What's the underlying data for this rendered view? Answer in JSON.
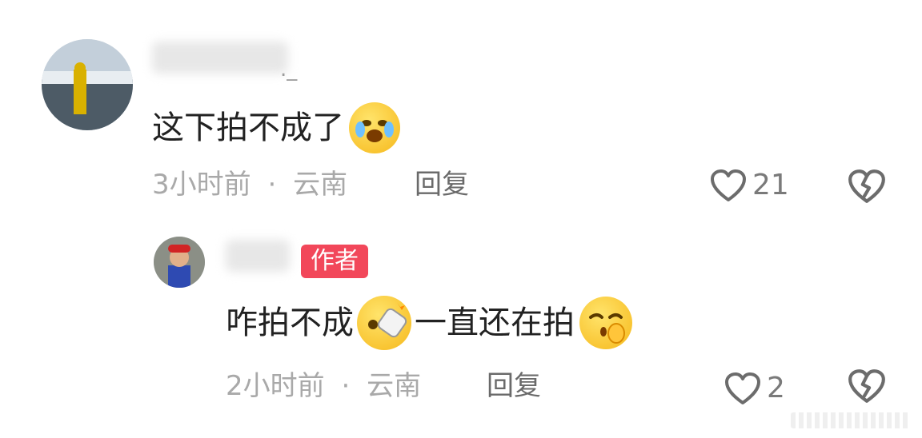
{
  "comments": [
    {
      "username_visible_suffix": "._",
      "text": "这下拍不成了",
      "emoji": "crying-laughing-emoji",
      "time": "3小时前",
      "location": "云南",
      "reply_label": "回复",
      "like_count": "21"
    },
    {
      "badge": "作者",
      "text_part1": "咋拍不成",
      "emoji1": "eraser-emoji",
      "text_part2": "一直还在拍",
      "emoji2": "smug-emoji",
      "time": "2小时前",
      "location": "云南",
      "reply_label": "回复",
      "like_count": "2"
    }
  ],
  "separator": "·",
  "icons": [
    "heart-outline-icon",
    "broken-heart-icon"
  ],
  "colors": {
    "badge": "#f2475a",
    "meta": "#a9a9a9"
  }
}
